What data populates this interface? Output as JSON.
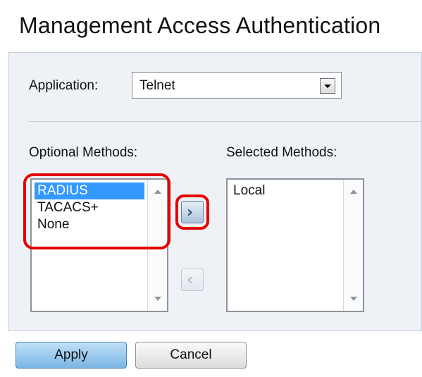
{
  "page": {
    "title": "Management Access Authentication"
  },
  "application": {
    "label": "Application:",
    "value": "Telnet"
  },
  "optional": {
    "label": "Optional Methods:",
    "items": [
      "RADIUS",
      "TACACS+",
      "None"
    ],
    "selected_index": 0
  },
  "selected": {
    "label": "Selected Methods:",
    "items": [
      "Local"
    ]
  },
  "buttons": {
    "apply": "Apply",
    "cancel": "Cancel"
  },
  "icons": {
    "move_right": "chevron-right-icon",
    "move_left": "chevron-left-icon"
  },
  "colors": {
    "highlight": "#e60000",
    "selection": "#3399ff",
    "panel": "#eef1f5"
  }
}
